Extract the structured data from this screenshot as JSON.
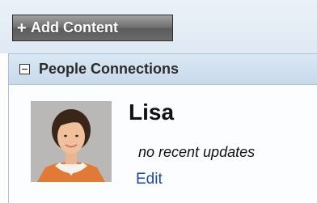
{
  "toolbar": {
    "add_content_label": "Add Content",
    "add_content_icon": "+"
  },
  "portlet": {
    "title": "People Connections",
    "toggle_icon": "minus-icon"
  },
  "profile": {
    "name": "Lisa",
    "status": "no recent updates",
    "edit_label": "Edit"
  }
}
